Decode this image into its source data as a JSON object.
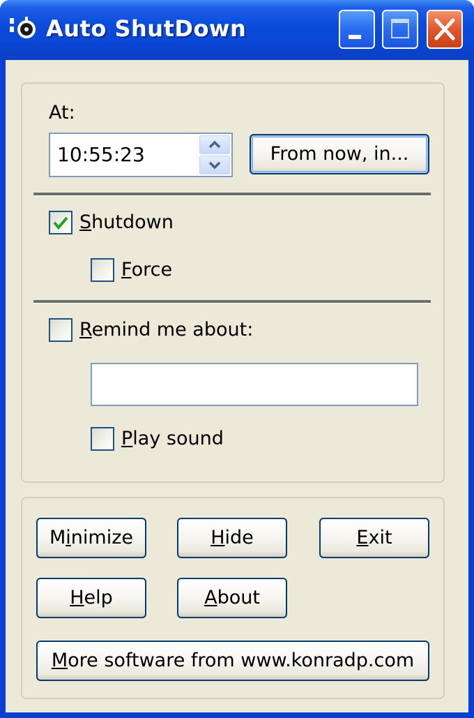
{
  "window": {
    "title": "Auto ShutDown",
    "app_icon": "app-icon",
    "controls": {
      "minimize_icon": "minimize-icon",
      "maximize_icon": "maximize-icon",
      "close_icon": "close-icon"
    }
  },
  "schedule": {
    "at_label": "At:",
    "time_value": "10:55:23",
    "spin_up_icon": "chevron-up-icon",
    "spin_down_icon": "chevron-down-icon",
    "from_now_label": "From now, in..."
  },
  "options": {
    "shutdown": {
      "label": "Shutdown",
      "mnemonic": "S",
      "rest": "hutdown",
      "checked": true
    },
    "force": {
      "label": "Force",
      "mnemonic": "F",
      "rest": "orce",
      "checked": false
    }
  },
  "reminder": {
    "remind": {
      "label": "Remind me about:",
      "mnemonic": "R",
      "rest": "emind me about:",
      "checked": false
    },
    "text_value": "",
    "sound": {
      "label": "Play sound",
      "mnemonic": "P",
      "rest": "lay sound",
      "checked": false
    }
  },
  "actions": {
    "minimize": {
      "label": "Minimize",
      "pre": "M",
      "mnemonic": "i",
      "rest": "nimize"
    },
    "hide": {
      "label": "Hide",
      "pre": "",
      "mnemonic": "H",
      "rest": "ide"
    },
    "exit": {
      "label": "Exit",
      "pre": "",
      "mnemonic": "E",
      "rest": "xit"
    },
    "help": {
      "label": "Help",
      "pre": "",
      "mnemonic": "H",
      "rest": "elp"
    },
    "about": {
      "label": "About",
      "pre": "",
      "mnemonic": "A",
      "rest": "bout"
    },
    "more": {
      "label": "More software from www.konradp.com",
      "pre": "",
      "mnemonic": "M",
      "rest": "ore software from www.konradp.com"
    }
  },
  "colors": {
    "titlebar": "#0a47d6",
    "client": "#ece9d8",
    "checkmark": "#21a121",
    "close_button": "#e2572c"
  }
}
